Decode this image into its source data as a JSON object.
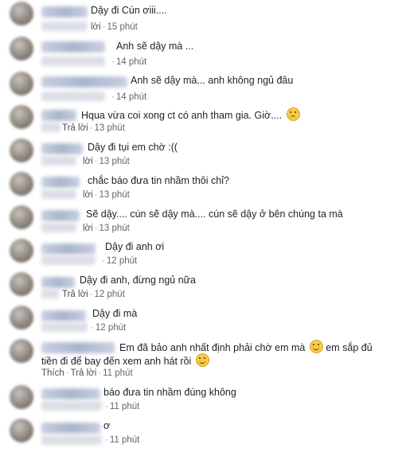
{
  "comments": [
    {
      "text": "Dậy đi Cún ơiii....",
      "reply": "lời",
      "time": "15 phút"
    },
    {
      "text": "Anh sẽ dậy mà ...",
      "time": "14 phút"
    },
    {
      "text": "Anh sẽ dậy mà... anh không ngủ đâu",
      "time": "14 phút"
    },
    {
      "text": "Hqua vừa coi xong ct có anh tham gia. Giờ....",
      "emoji": "sad-face",
      "reply": "Trả lời",
      "time": "13 phút"
    },
    {
      "text": "Dậy đi tụi em chờ :((",
      "reply": "lời",
      "time": "13 phút"
    },
    {
      "text": "chắc báo đưa tin nhầm thôi chỉ?",
      "reply": "lời",
      "time": "13 phút"
    },
    {
      "text": "Sẽ dậy.... cún sẽ dậy mà.... cún sẽ dậy ở bên chúng ta mà",
      "reply": "lời",
      "time": "13 phút"
    },
    {
      "text": "Dậy đi anh ơi",
      "time": "12 phút"
    },
    {
      "text": "Dậy đi anh, đừng ngủ nữa",
      "reply": "Trả lời",
      "time": "12 phút"
    },
    {
      "text": "Dậy đi mà",
      "time": "12 phút"
    },
    {
      "text_line1": "Em đã bảo anh nhất định phải chờ em mà",
      "text_line1b": "em sắp đủ",
      "text_line2": "tiền đi để bay đến xem anh hát rồi",
      "emoji": "smile-face",
      "like": "Thích",
      "reply": "Trả lời",
      "time": "11 phút"
    },
    {
      "text": "báo đưa tin nhầm đúng không",
      "time": "11 phút"
    },
    {
      "text": "ơ",
      "time": "11 phút"
    }
  ],
  "separator": "·"
}
